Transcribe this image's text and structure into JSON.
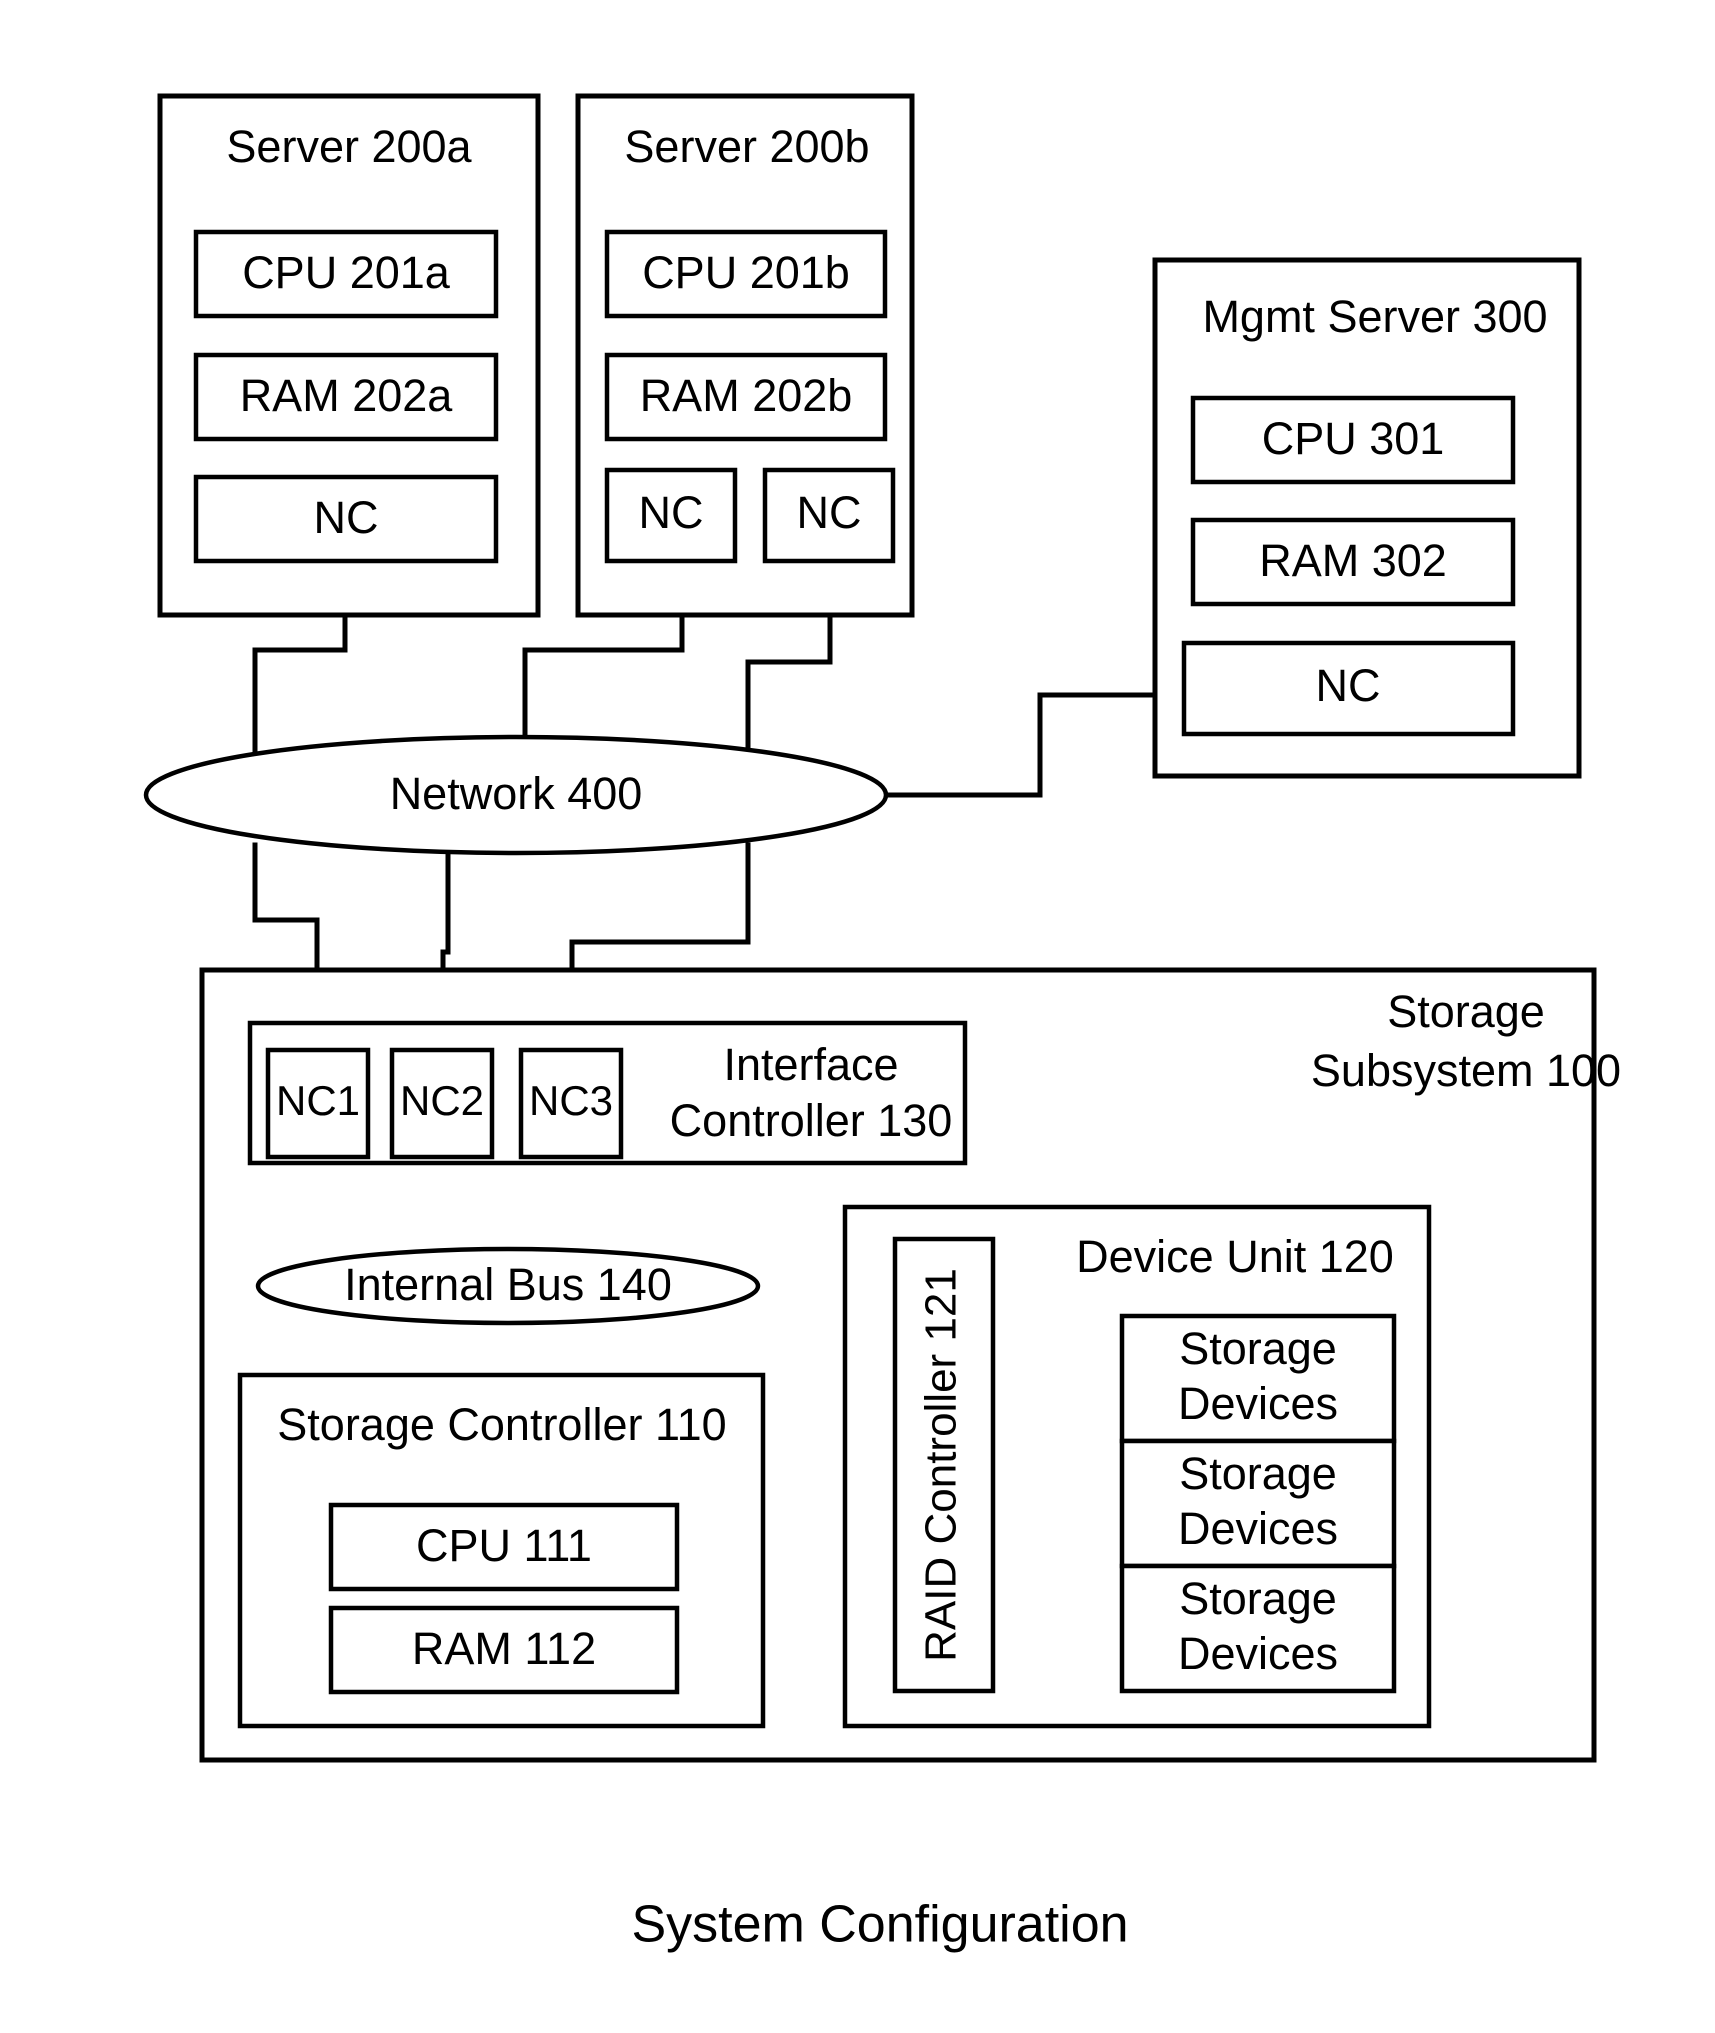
{
  "caption": "System Configuration",
  "servers": [
    {
      "title": "Server 200a",
      "cpu": "CPU 201a",
      "ram": "RAM 202a",
      "nics": [
        "NC"
      ]
    },
    {
      "title": "Server 200b",
      "cpu": "CPU 201b",
      "ram": "RAM 202b",
      "nics": [
        "NC",
        "NC"
      ]
    }
  ],
  "mgmt_server": {
    "title": "Mgmt Server 300",
    "cpu": "CPU 301",
    "ram": "RAM 302",
    "nic": "NC"
  },
  "network": {
    "label": "Network 400"
  },
  "storage_subsystem": {
    "title_line1": "Storage",
    "title_line2": "Subsystem 100",
    "interface_controller": {
      "title_line1": "Interface",
      "title_line2": "Controller 130",
      "nics": [
        "NC1",
        "NC2",
        "NC3"
      ]
    },
    "internal_bus": {
      "label": "Internal Bus 140"
    },
    "storage_controller": {
      "title": "Storage Controller 110",
      "cpu": "CPU 111",
      "ram": "RAM 112"
    },
    "device_unit": {
      "title": "Device Unit 120",
      "raid_controller": "RAID Controller 121",
      "storage_devices": [
        {
          "line1": "Storage",
          "line2": "Devices"
        },
        {
          "line1": "Storage",
          "line2": "Devices"
        },
        {
          "line1": "Storage",
          "line2": "Devices"
        }
      ]
    }
  },
  "colors": {
    "line": "#000000",
    "fill": "#ffffff"
  }
}
